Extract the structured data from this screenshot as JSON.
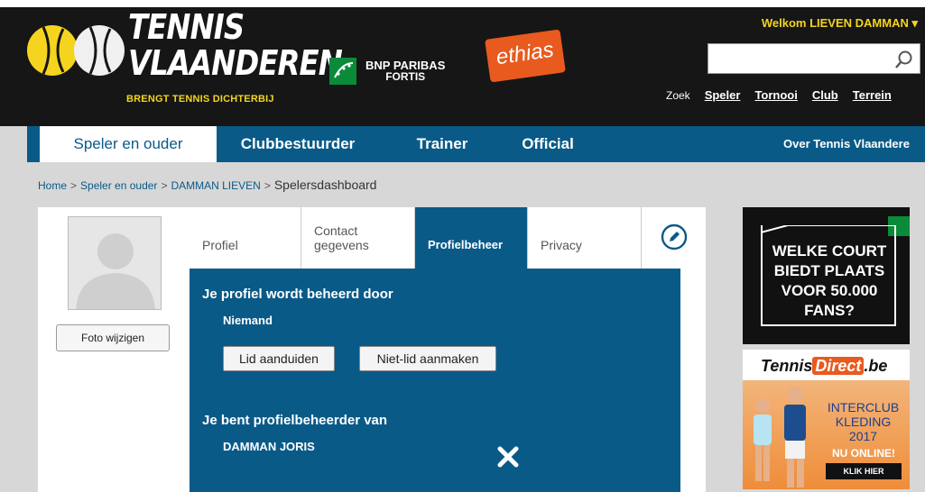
{
  "header": {
    "logo_line1": "TENNIS",
    "logo_line2": "VLAANDEREN",
    "tagline": "BRENGT TENNIS DICHTERBIJ",
    "sponsor1_line1": "BNP PARIBAS",
    "sponsor1_line2": "FORTIS",
    "sponsor2": "ethias",
    "welcome": "Welkom LIEVEN DAMMAN ▾",
    "search_placeholder": "",
    "search_value": "",
    "zoek_label": "Zoek",
    "quick_links": [
      "Speler",
      "Tornooi",
      "Club",
      "Terrein"
    ]
  },
  "nav": {
    "items": [
      "Speler en ouder",
      "Clubbestuurder",
      "Trainer",
      "Official"
    ],
    "right_item": "Over Tennis Vlaandere"
  },
  "breadcrumb": {
    "items": [
      "Home",
      "Speler en ouder",
      "DAMMAN LIEVEN"
    ],
    "separator": ">",
    "current": "Spelersdashboard"
  },
  "sidebar": {
    "photo_button": "Foto wijzigen"
  },
  "tabs": {
    "items": [
      "Profiel",
      "Contact gegevens",
      "Profielbeheer",
      "Privacy"
    ],
    "active": "Profielbeheer"
  },
  "panel": {
    "managed_by_title": "Je profiel wordt beheerd door",
    "managed_by_value": "Niemand",
    "btn_assign_member": "Lid aanduiden",
    "btn_create_nonmember": "Niet-lid aanmaken",
    "manager_of_title": "Je bent profielbeheerder van",
    "manager_of_value": "DAMMAN JORIS"
  },
  "ads": {
    "ad1_text": [
      "WELKE COURT",
      "BIEDT PLAATS",
      "VOOR 50.000 FANS?"
    ],
    "ad2_brand_a": "Tennis",
    "ad2_brand_b": "Direct",
    "ad2_brand_c": ".be",
    "ad2_line1": "INTERCLUB",
    "ad2_line2": "KLEDING",
    "ad2_line3": "2017",
    "ad2_online": "NU ONLINE!",
    "ad2_cta": "KLIK HIER"
  },
  "colors": {
    "brand_blue": "#0a5a88",
    "brand_yellow": "#f4d41f",
    "header_bg": "#161616"
  }
}
